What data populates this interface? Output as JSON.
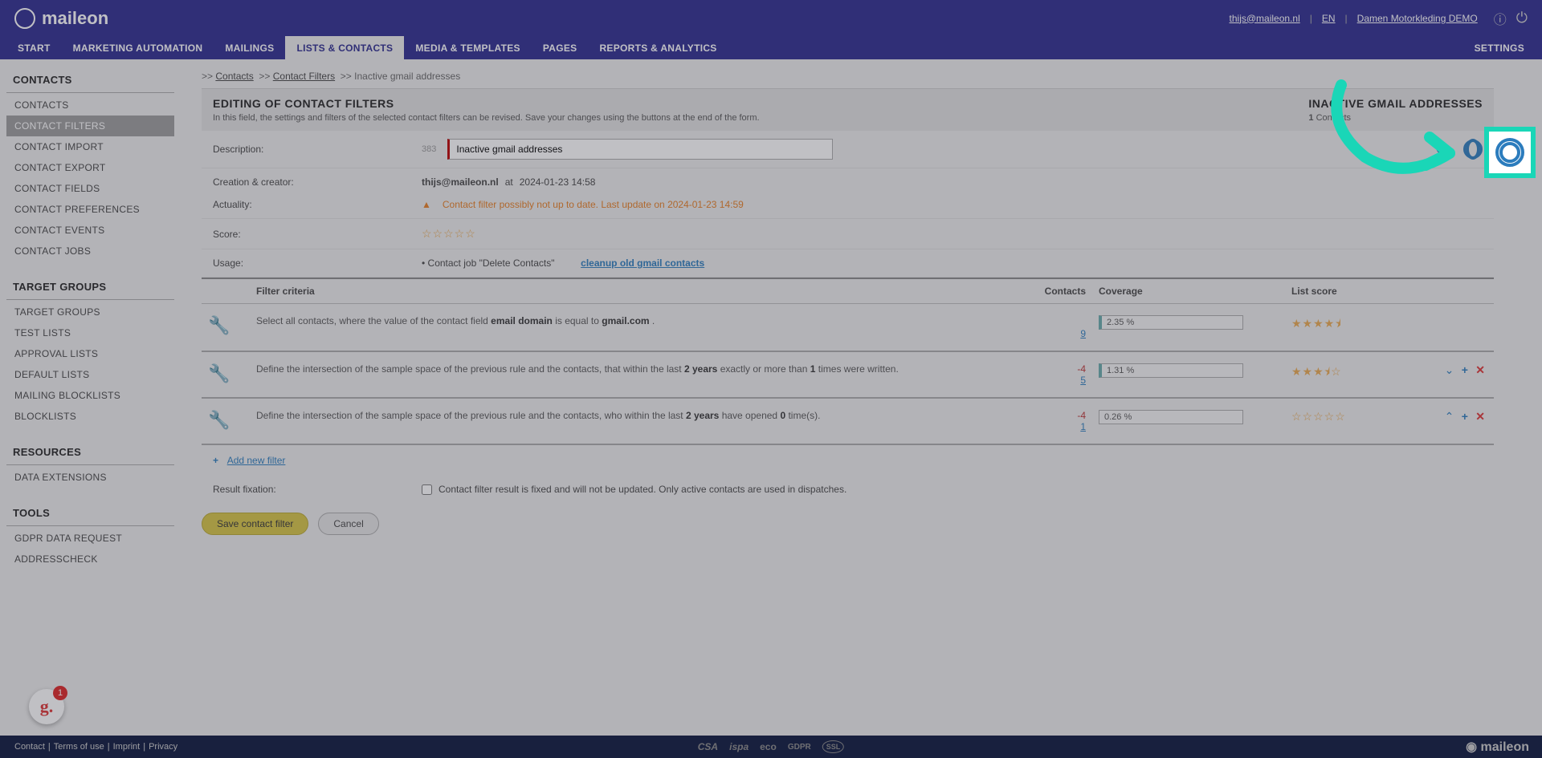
{
  "header": {
    "logo": "maileon",
    "user_email": "thijs@maileon.nl",
    "lang": "EN",
    "tenant": "Damen Motorkleding DEMO"
  },
  "nav": {
    "items": [
      "START",
      "MARKETING AUTOMATION",
      "MAILINGS",
      "LISTS & CONTACTS",
      "MEDIA & TEMPLATES",
      "PAGES",
      "REPORTS & ANALYTICS"
    ],
    "settings": "SETTINGS",
    "active_index": 3
  },
  "sidebar": {
    "sections": [
      {
        "head": "CONTACTS",
        "items": [
          "CONTACTS",
          "CONTACT FILTERS",
          "CONTACT IMPORT",
          "CONTACT EXPORT",
          "CONTACT FIELDS",
          "CONTACT PREFERENCES",
          "CONTACT EVENTS",
          "CONTACT JOBS"
        ],
        "active": 1
      },
      {
        "head": "TARGET GROUPS",
        "items": [
          "TARGET GROUPS",
          "TEST LISTS",
          "APPROVAL LISTS",
          "DEFAULT LISTS",
          "MAILING BLOCKLISTS",
          "BLOCKLISTS"
        ],
        "active": -1
      },
      {
        "head": "RESOURCES",
        "items": [
          "DATA EXTENSIONS"
        ],
        "active": -1
      },
      {
        "head": "TOOLS",
        "items": [
          "GDPR DATA REQUEST",
          "ADDRESSCHECK"
        ],
        "active": -1
      }
    ]
  },
  "breadcrumb": {
    "contacts": "Contacts",
    "filters": "Contact Filters",
    "current": "Inactive gmail addresses"
  },
  "panel": {
    "title": "EDITING OF CONTACT FILTERS",
    "subtitle": "In this field, the settings and filters of the selected contact filters can be revised. Save your changes using the buttons at the end of the form.",
    "right_title": "INACTIVE GMAIL ADDRESSES",
    "right_count": "1",
    "right_label": "Contacts"
  },
  "form": {
    "description_label": "Description:",
    "description_value": "Inactive gmail addresses",
    "description_counter": "383",
    "creation_label": "Creation & creator:",
    "creator": "thijs@maileon.nl",
    "at": "at",
    "created": "2024-01-23 14:58",
    "actuality_label": "Actuality:",
    "actuality_msg": "Contact filter possibly not up to date. Last update on 2024-01-23 14:59",
    "score_label": "Score:",
    "usage_label": "Usage:",
    "usage_text": "• Contact job \"Delete Contacts\"",
    "usage_link": "cleanup old gmail contacts",
    "result_label": "Result fixation:",
    "result_text": "Contact filter result is fixed and will not be updated. Only active contacts are used in dispatches."
  },
  "table": {
    "headers": {
      "criteria": "Filter criteria",
      "contacts": "Contacts",
      "coverage": "Coverage",
      "score": "List score"
    },
    "rows": [
      {
        "text_pre": "Select all contacts, where the value of the contact field ",
        "b1": "email domain",
        "mid": " is equal to ",
        "b2": "gmail.com",
        "post": " .",
        "count": "9",
        "neg": "",
        "coverage": "2.35 %",
        "stars": "★★★★⯨",
        "actions": false
      },
      {
        "text_pre": "Define the intersection of the sample space of the previous rule and the contacts, that within the last ",
        "b1": "2 years",
        "mid": " exactly or more than ",
        "b2": "1",
        "post": " times were written.",
        "count": "5",
        "neg": "-4",
        "coverage": "1.31 %",
        "stars": "★★★⯨☆",
        "actions": true
      },
      {
        "text_pre": "Define the intersection of the sample space of the previous rule and the contacts, who within the last ",
        "b1": "2 years",
        "mid": " have opened ",
        "b2": "0",
        "post": " time(s).",
        "count": "1",
        "neg": "-4",
        "coverage": "0.26 %",
        "stars": "☆☆☆☆☆",
        "actions": true
      }
    ],
    "add_filter": "Add new filter"
  },
  "buttons": {
    "save": "Save contact filter",
    "cancel": "Cancel"
  },
  "footer": {
    "contact": "Contact",
    "terms": "Terms of use",
    "imprint": "Imprint",
    "privacy": "Privacy",
    "badges": [
      "CSA",
      "ispa",
      "eco",
      "GDPR",
      "SSL"
    ],
    "logo": "maileon"
  },
  "badge_g": "1"
}
